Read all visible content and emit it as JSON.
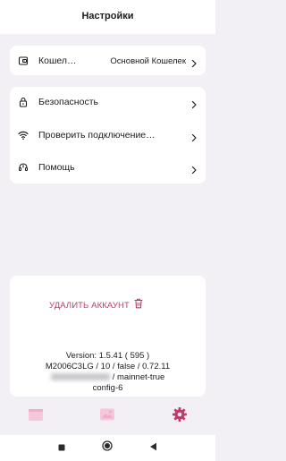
{
  "header": {
    "title": "Настройки"
  },
  "wallet": {
    "label": "Кошел…",
    "value": "Основной Кошелек",
    "icon": "wallet-icon"
  },
  "menu": {
    "items": [
      {
        "label": "Безопасность",
        "icon": "lock-icon"
      },
      {
        "label": "Проверить подключение…",
        "icon": "wifi-icon"
      },
      {
        "label": "Помощь",
        "icon": "headset-icon"
      }
    ]
  },
  "account": {
    "delete_label": "УДАЛИТЬ АККАУНТ",
    "delete_icon": "trash-icon"
  },
  "version_info": {
    "line1": "Version: 1.5.41 ( 595 )",
    "line2": "M2006C3LG / 10 / false / 0.72.11",
    "line3": "/ mainnet-true",
    "line4": "config-6"
  },
  "tabs": [
    {
      "icon": "wallet-tab-icon",
      "active": false
    },
    {
      "icon": "gallery-tab-icon",
      "active": false
    },
    {
      "icon": "settings-tab-icon",
      "active": true
    }
  ],
  "colors": {
    "accent": "#c0396b",
    "inactive_tab": "#f5c6dc",
    "background": "#f2f0f5"
  },
  "system_nav": [
    "recent-apps-icon",
    "home-icon",
    "back-icon"
  ]
}
